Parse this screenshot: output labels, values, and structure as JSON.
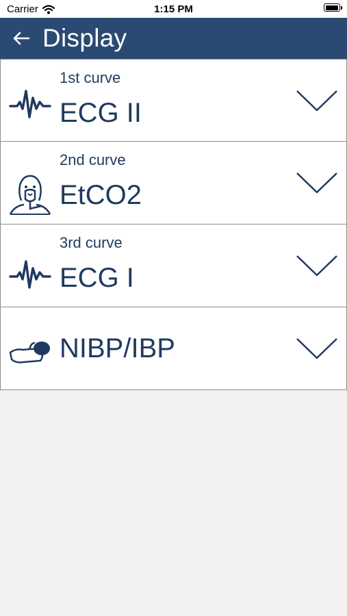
{
  "status_bar": {
    "carrier": "Carrier",
    "time": "1:15 PM",
    "battery_level": 1.0
  },
  "header": {
    "title": "Display",
    "back_icon": "arrow-left-icon",
    "background_color": "#2b4a73"
  },
  "rows": [
    {
      "caption": "1st curve",
      "value": "ECG II",
      "icon": "ecg-waveform-icon",
      "control": "chevron-down-icon"
    },
    {
      "caption": "2nd curve",
      "value": "EtCO2",
      "icon": "patient-mask-icon",
      "control": "chevron-down-icon"
    },
    {
      "caption": "3rd curve",
      "value": "ECG I",
      "icon": "ecg-waveform-icon",
      "control": "chevron-down-icon"
    },
    {
      "caption": "",
      "value": "NIBP/IBP",
      "icon": "blood-pressure-cuff-icon",
      "control": "chevron-down-icon"
    }
  ],
  "colors": {
    "text": "#1f3a5f",
    "divider": "#8c8c8c",
    "background": "#f2f2f2"
  }
}
